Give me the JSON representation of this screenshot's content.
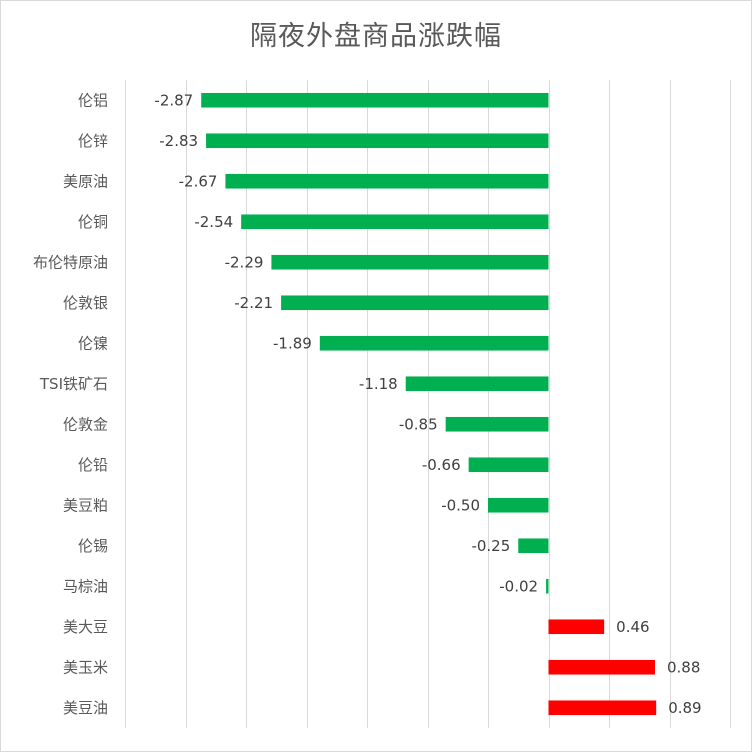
{
  "chart_data": {
    "type": "bar",
    "orientation": "horizontal",
    "title": "隔夜外盘商品涨跌幅",
    "xlabel": "",
    "ylabel": "",
    "xlim": [
      -3.5,
      1.5
    ],
    "grid_step": 0.5,
    "grid": true,
    "legend": "none",
    "tick_labels_visible": false,
    "categories": [
      "伦铝",
      "伦锌",
      "美原油",
      "伦铜",
      "布伦特原油",
      "伦敦银",
      "伦镍",
      "TSI铁矿石",
      "伦敦金",
      "伦铅",
      "美豆粕",
      "伦锡",
      "马棕油",
      "美大豆",
      "美玉米",
      "美豆油"
    ],
    "values": [
      -2.87,
      -2.83,
      -2.67,
      -2.54,
      -2.29,
      -2.21,
      -1.89,
      -1.18,
      -0.85,
      -0.66,
      -0.5,
      -0.25,
      -0.02,
      0.46,
      0.88,
      0.89
    ],
    "data_labels": [
      "-2.87",
      "-2.83",
      "-2.67",
      "-2.54",
      "-2.29",
      "-2.21",
      "-1.89",
      "-1.18",
      "-0.85",
      "-0.66",
      "-0.50",
      "-0.25",
      "-0.02",
      "0.46",
      "0.88",
      "0.89"
    ],
    "colors": {
      "negative": "#00B050",
      "positive": "#FF0000",
      "grid": "#d9d9d9",
      "text": "#595959"
    }
  }
}
